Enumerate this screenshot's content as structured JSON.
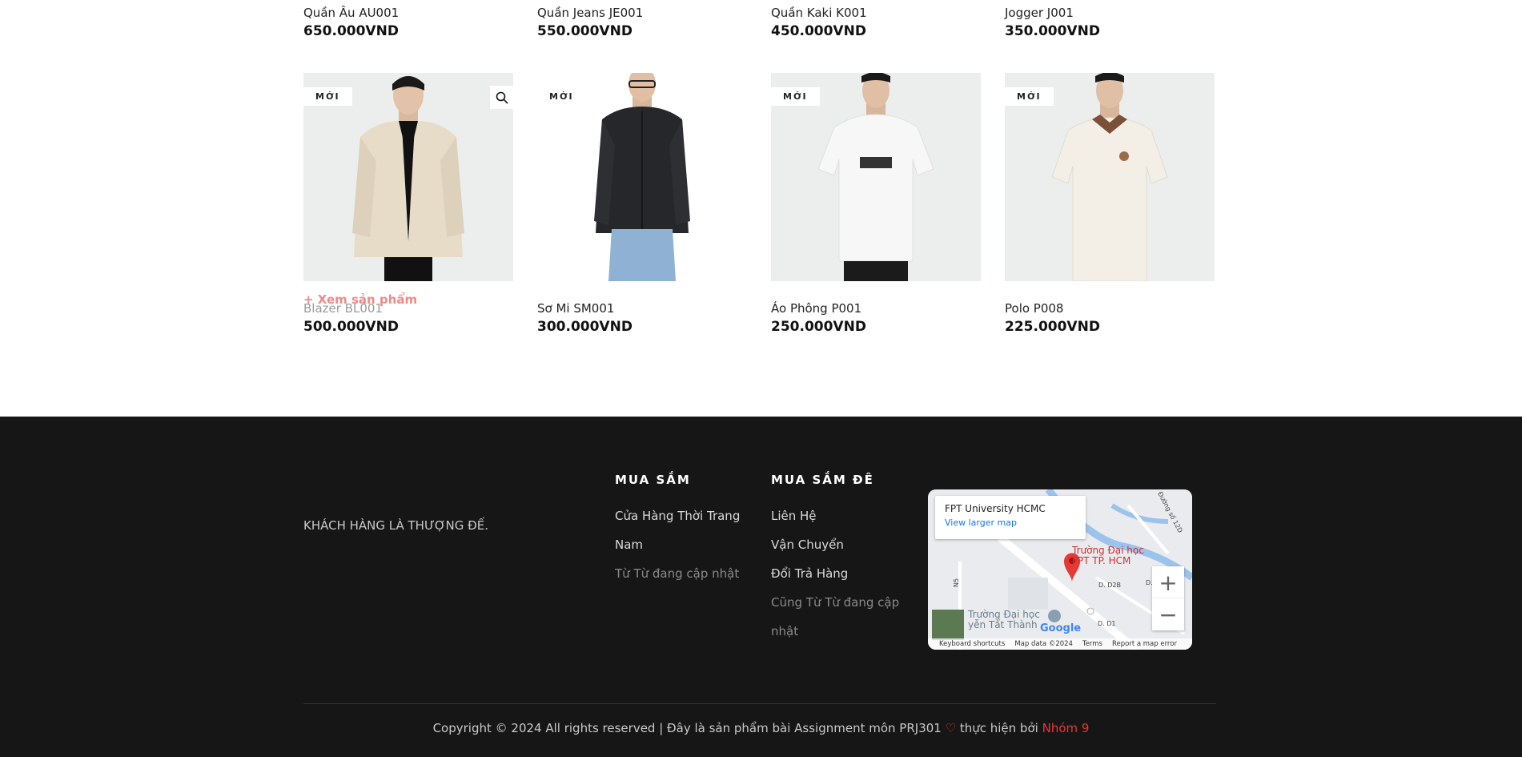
{
  "products_top": [
    {
      "name": "Quần Âu AU001",
      "price": "650.000VND"
    },
    {
      "name": "Quần Jeans JE001",
      "price": "550.000VND"
    },
    {
      "name": "Quần Kaki K001",
      "price": "450.000VND"
    },
    {
      "name": "Jogger J001",
      "price": "350.000VND"
    }
  ],
  "products": [
    {
      "badge": "MỚI",
      "name": "Blazer BL001",
      "price": "500.000VND",
      "view_label": "+ Xem sản phẩm",
      "hovered": true,
      "image": "beige-blazer-photo"
    },
    {
      "badge": "MỚI",
      "name": "Sơ Mi SM001",
      "price": "300.000VND",
      "image": "black-shirt-photo"
    },
    {
      "badge": "MỚI",
      "name": "Áo Phông P001",
      "price": "250.000VND",
      "image": "white-tshirt-photo"
    },
    {
      "badge": "MỚI",
      "name": "Polo P008",
      "price": "225.000VND",
      "image": "polo-shirt-photo"
    }
  ],
  "footer": {
    "slogan": "KHÁCH HÀNG LÀ THƯỢNG ĐẾ.",
    "col1": {
      "title": "MUA SẮM",
      "links": [
        "Cửa Hàng Thời Trang",
        "Nam"
      ],
      "muted": "Từ Từ đang cập nhật"
    },
    "col2": {
      "title": "MUA SẮM ĐÊ",
      "links": [
        "Liên Hệ",
        "Vận Chuyển",
        "Đổi Trả Hàng"
      ],
      "muted": [
        "Cũng Từ Từ đang cập",
        "nhật"
      ]
    },
    "map": {
      "place_title": "FPT University HCMC",
      "larger_map": "View larger map",
      "pin_label_1": "Trường Đại học",
      "pin_label_2": "FPT TP. HCM",
      "poi_1": "Trường Đại học",
      "poi_2": "yễn Tất Thành",
      "streets": [
        "D. D2B",
        "D. D9",
        "D. D1",
        "N5",
        "Đường số 12D"
      ],
      "google": "Google",
      "zoom_in": "+",
      "zoom_out": "−",
      "bar": [
        "Keyboard shortcuts",
        "Map data ©2024",
        "Terms",
        "Report a map error"
      ]
    },
    "copyright_pre": "Copyright © 2024 All rights reserved | Đây là sản phẩm bài Assignment môn PRJ301",
    "copyright_mid": "thực hiện bởi",
    "team": "Nhóm 9"
  },
  "colors": {
    "footer_bg": "#161616",
    "accent_red": "#e33333",
    "view_link": "#f08a8a"
  }
}
